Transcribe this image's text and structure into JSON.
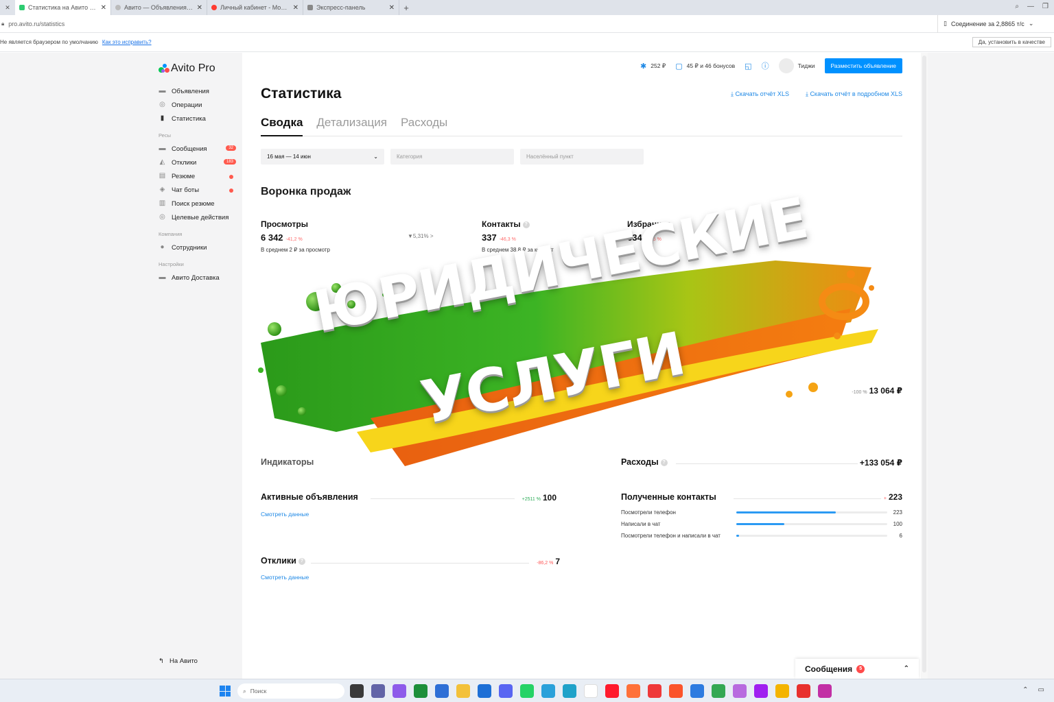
{
  "browser": {
    "tabs": [
      {
        "title": "Статистика на Авито Pro",
        "active": true,
        "color": "#2ecc71"
      },
      {
        "title": "Авито — Объявления на",
        "active": false,
        "color": "#888888"
      },
      {
        "title": "Личный кабинет - Мои п",
        "active": false,
        "color": "#ff3b30"
      },
      {
        "title": "Экспресс-панель",
        "active": false,
        "color": "#777777"
      }
    ],
    "url": "pro.avito.ru/statistics",
    "sync_label": "Соединение за 2,8865 т/с",
    "info_text": "Не является браузером по умолчанию",
    "info_link": "Как это исправить?",
    "info_button": "Да, установить в качестве"
  },
  "logo": {
    "brand": "Avito Pro"
  },
  "sidebar": {
    "items": [
      {
        "label": "Объявления",
        "icon": "listing-icon"
      },
      {
        "label": "Операции",
        "icon": "operations-icon"
      },
      {
        "label": "Статистика",
        "icon": "chart-icon"
      }
    ],
    "group_tools": "Ресы",
    "tools": [
      {
        "label": "Сообщения",
        "icon": "message-icon",
        "badge": "32"
      },
      {
        "label": "Отклики",
        "icon": "response-icon",
        "badge": "183"
      },
      {
        "label": "Резюме",
        "icon": "resume-icon",
        "dot": true
      },
      {
        "label": "Чат боты",
        "icon": "bot-icon",
        "dot": true
      },
      {
        "label": "Поиск резюме",
        "icon": "search-resume-icon"
      },
      {
        "label": "Целевые действия",
        "icon": "target-icon"
      }
    ],
    "group_company": "Компания",
    "company": [
      {
        "label": "Сотрудники",
        "icon": "user-icon"
      }
    ],
    "group_settings": "Настройки",
    "settings": [
      {
        "label": "Авито Доставка",
        "icon": "delivery-icon"
      }
    ],
    "back_label": "На Авито"
  },
  "topbar": {
    "balance": "252 ₽",
    "bonuses": "45 ₽ и 46 бонусов",
    "user": "Тиджи",
    "post_button": "Разместить объявление"
  },
  "page": {
    "title": "Статистика",
    "download_xls": "Скачать отчёт XLS",
    "download_xls_2": "Скачать отчёт в подробном XLS",
    "tabs": [
      "Сводка",
      "Детализация",
      "Расходы"
    ],
    "filters": {
      "date": "16 мая — 14 июн",
      "category": "Категория",
      "region": "Населённый пункт"
    },
    "funnel_title": "Воронка продаж",
    "metrics": [
      {
        "label": "Просмотры",
        "value": "6 342",
        "delta": "-41,2 %",
        "sub": "В среднем 2 ₽ за просмотр"
      },
      {
        "label": "Контакты",
        "value": "337",
        "delta": "-46,3 %",
        "sub": "В среднем 38,8 ₽ за контакт"
      },
      {
        "label": "Избранное",
        "value": "634",
        "delta": "-40,5 %",
        "sub": ""
      }
    ],
    "conversion": "5,31% >",
    "total_value": "13 064 ₽",
    "total_delta": "-100 %",
    "indicators_label": "Индикаторы",
    "expenses_label": "Расходы",
    "expenses_value": "+133 054 ₽",
    "active_ads_label": "Активные объявления",
    "active_ads_value": "100",
    "active_ads_delta": "+2511 %",
    "active_ads_link": "Смотреть данные",
    "contacts_label": "Полученные контакты",
    "contacts_value": "223",
    "contacts_delta": "+",
    "contacts_rows": [
      {
        "label": "Посмотрели телефон",
        "value": "223",
        "fraction": 0.66
      },
      {
        "label": "Написали в чат",
        "value": "100",
        "fraction": 0.32
      },
      {
        "label": "Посмотрели телефон и написали в чат",
        "value": "6",
        "fraction": 0.02
      }
    ],
    "responses_label": "Отклики",
    "responses_value": "7",
    "responses_delta": "-86,2 %",
    "responses_link": "Смотреть данные"
  },
  "banner": {
    "line1": "ЮРИДИЧЕСКИЕ",
    "line2": "УСЛУГИ"
  },
  "messages_widget": {
    "label": "Сообщения",
    "count": "5"
  },
  "taskbar": {
    "search_placeholder": "Поиск"
  },
  "colors": {
    "accent": "#0091ff",
    "link": "#1e88e5",
    "danger": "#ff5a4e",
    "banner_green": "#2fa51b",
    "banner_orange": "#f26a12",
    "banner_yellow": "#f7d51b"
  }
}
